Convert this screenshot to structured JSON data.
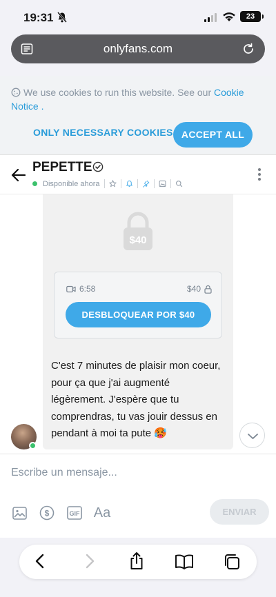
{
  "status_bar": {
    "time": "19:31",
    "battery": "23"
  },
  "browser": {
    "url": "onlyfans.com"
  },
  "cookie_banner": {
    "message": "We use cookies to run this website. See our",
    "link": "Cookie Notice",
    "link_suffix": ".",
    "necessary_label": "ONLY NECESSARY COOKIES",
    "accept_label": "ACCEPT ALL"
  },
  "chat_header": {
    "name": "PEPETTE",
    "status": "Disponible ahora"
  },
  "media_message": {
    "lock_price": "$40",
    "duration": "6:58",
    "price": "$40",
    "unlock_label": "DESBLOQUEAR POR $40"
  },
  "text_message": {
    "body": "C'est 7 minutes de plaisir mon coeur, pour ça que j'ai augmenté légèrement. J'espère que tu comprendras, tu vas jouir dessus en pendant à moi ta pute 🥵"
  },
  "composer": {
    "placeholder": "Escribe un mensaje...",
    "gif_label": "GIF",
    "format_label": "Aa",
    "send_label": "ENVIAR"
  },
  "colors": {
    "accent": "#3fa9e8",
    "online": "#3bc16c",
    "muted": "#8a96a3"
  }
}
